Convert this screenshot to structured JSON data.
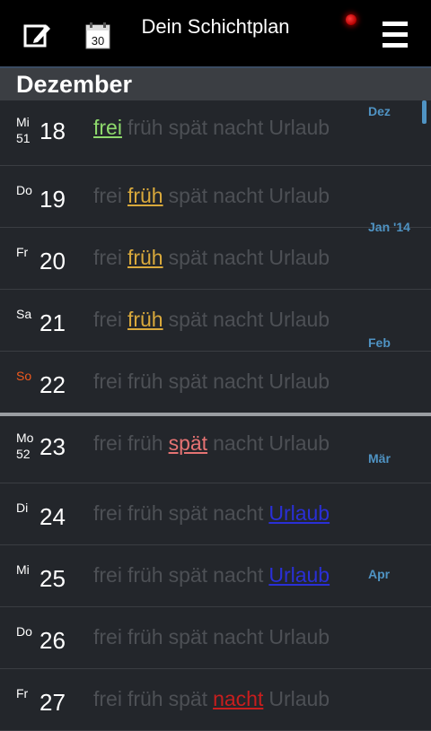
{
  "app": {
    "title": "Dein Schichtplan"
  },
  "toolbar": {
    "edit_icon": "edit-icon",
    "calendar_icon": "calendar-icon",
    "calendar_day": "30",
    "menu_icon": "menu-icon"
  },
  "month_header": "Dezember",
  "shift_labels": [
    "frei",
    "früh",
    "spät",
    "nacht",
    "Urlaub"
  ],
  "days": [
    {
      "dow": "Mi",
      "week": "51",
      "day": "18",
      "selected": "frei"
    },
    {
      "dow": "Do",
      "week": "",
      "day": "19",
      "selected": "früh"
    },
    {
      "dow": "Fr",
      "week": "",
      "day": "20",
      "selected": "früh"
    },
    {
      "dow": "Sa",
      "week": "",
      "day": "21",
      "selected": "früh"
    },
    {
      "dow": "So",
      "week": "",
      "day": "22",
      "selected": ""
    },
    {
      "dow": "Mo",
      "week": "52",
      "day": "23",
      "selected": "spät"
    },
    {
      "dow": "Di",
      "week": "",
      "day": "24",
      "selected": "Urlaub"
    },
    {
      "dow": "Mi",
      "week": "",
      "day": "25",
      "selected": "Urlaub"
    },
    {
      "dow": "Do",
      "week": "",
      "day": "26",
      "selected": ""
    },
    {
      "dow": "Fr",
      "week": "",
      "day": "27",
      "selected": "nacht"
    }
  ],
  "month_index": [
    "Dez",
    "Jan '14",
    "Feb",
    "Mär",
    "Apr"
  ],
  "colors": {
    "frei": "#8ed96c",
    "früh": "#d9a93c",
    "spät": "#e57373",
    "nacht": "#c81e1e",
    "Urlaub": "#2a2fd6",
    "sunday": "#f25a1d",
    "accent": "#4f93c3"
  }
}
